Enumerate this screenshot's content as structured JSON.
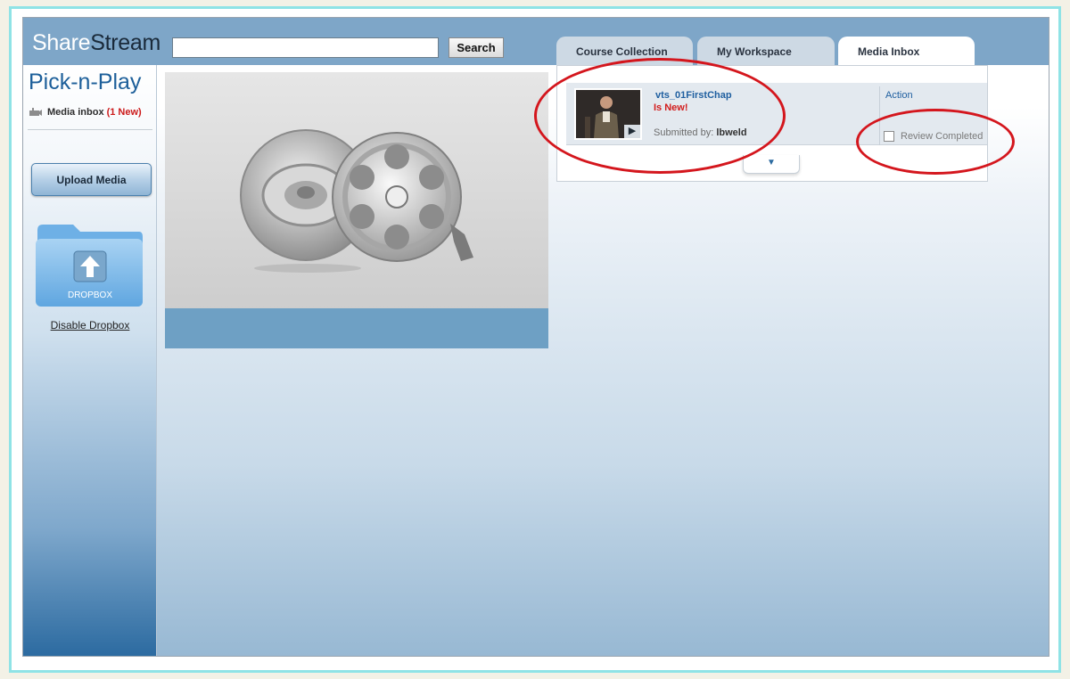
{
  "app": {
    "logo_part1": "Share",
    "logo_part2": "Stream",
    "search_placeholder": "",
    "search_button": "Search"
  },
  "tabs": [
    {
      "label": "Course Collection",
      "active": false
    },
    {
      "label": "My Workspace",
      "active": false
    },
    {
      "label": "Media Inbox",
      "active": true
    }
  ],
  "sidebar": {
    "title": "Pick-n-Play",
    "inbox_label": "Media inbox",
    "inbox_new": "(1 New)",
    "upload_button": "Upload Media",
    "dropbox_label": "DROPBOX",
    "disable_link": "Disable Dropbox"
  },
  "inbox": {
    "item": {
      "title": "vts_01FirstChap",
      "new_flag": "Is New!",
      "submitted_label": "Submitted by:",
      "submitted_by": "lbweld"
    },
    "action_header": "Action",
    "review_label": "Review Completed"
  },
  "colors": {
    "header": "#7ea6c8",
    "accent": "#1f5fa0",
    "alert": "#d21c1c",
    "annotation": "#d4161d"
  }
}
